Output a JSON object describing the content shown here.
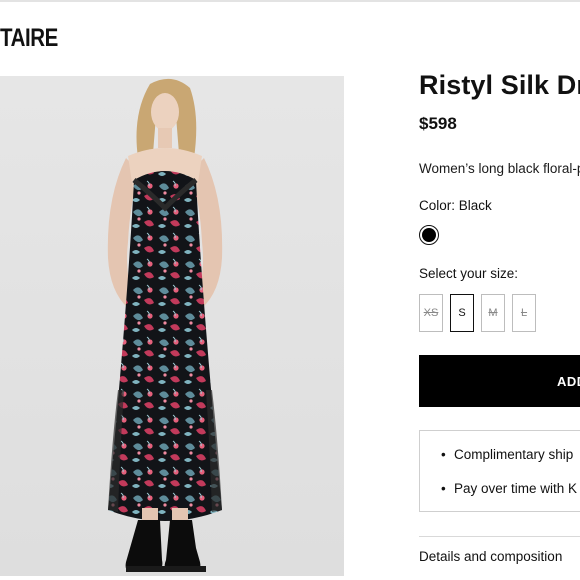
{
  "header": {
    "brand": "TAIRE"
  },
  "product": {
    "title": "Ristyl Silk Dr",
    "price": "$598",
    "description": "Women’s long black floral-p",
    "color_label": "Color: Black",
    "selected_color": "#000000",
    "size_label": "Select your size:",
    "sizes": [
      {
        "label": "XS",
        "available": false,
        "selected": false
      },
      {
        "label": "S",
        "available": true,
        "selected": true
      },
      {
        "label": "M",
        "available": false,
        "selected": false
      },
      {
        "label": "L",
        "available": false,
        "selected": false
      }
    ],
    "add_button_label": "ADD",
    "info_items": [
      "Complimentary ship",
      "Pay over time with K"
    ],
    "details_label": "Details and composition"
  },
  "photo": {
    "icon": "product-photo"
  }
}
